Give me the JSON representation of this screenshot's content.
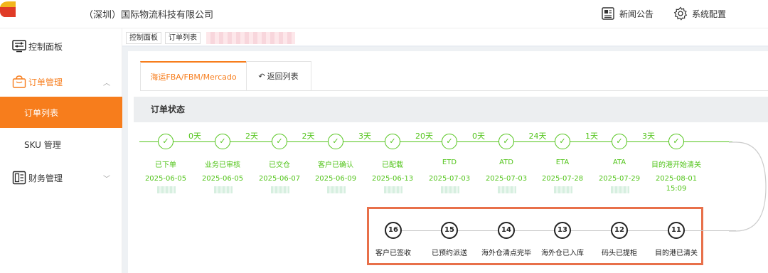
{
  "header": {
    "company": "（深圳）国际物流科技有限公司",
    "news_label": "新闻公告",
    "config_label": "系统配置"
  },
  "sidebar": {
    "items": [
      {
        "label": "控制面板",
        "icon": "dashboard-icon"
      },
      {
        "label": "订单管理",
        "icon": "shopping-bag-icon",
        "color": "#f77d1c"
      },
      {
        "label": "订单列表",
        "active": true
      },
      {
        "label": "SKU 管理"
      },
      {
        "label": "财务管理",
        "icon": "ledger-icon"
      }
    ]
  },
  "tabs": [
    "控制面板",
    "订单列表"
  ],
  "panel": {
    "active_tab": "海运FBA/FBM/Mercado",
    "back_tab": "返回列表",
    "section_title": "订单状态"
  },
  "steps": [
    {
      "label": "已下单",
      "date": "2025-06-05"
    },
    {
      "label": "业务已审核",
      "date": "2025-06-05"
    },
    {
      "label": "已交仓",
      "date": "2025-06-07"
    },
    {
      "label": "客户已确认",
      "date": "2025-06-09"
    },
    {
      "label": "已配载",
      "date": "2025-06-13"
    },
    {
      "label": "ETD",
      "date": "2025-07-03"
    },
    {
      "label": "ATD",
      "date": "2025-07-03"
    },
    {
      "label": "ETA",
      "date": "2025-07-28"
    },
    {
      "label": "ATA",
      "date": "2025-07-29"
    },
    {
      "label": "目的港开始清关",
      "date": "2025-08-01",
      "time": "15:09"
    }
  ],
  "durations": [
    "0天",
    "2天",
    "2天",
    "3天",
    "20天",
    "0天",
    "24天",
    "1天",
    "3天"
  ],
  "pending_steps": [
    {
      "num": "16",
      "label": "客户已签收"
    },
    {
      "num": "15",
      "label": "已预约派送"
    },
    {
      "num": "14",
      "label": "海外仓清点完毕"
    },
    {
      "num": "13",
      "label": "海外仓已入库"
    },
    {
      "num": "12",
      "label": "码头已提柜"
    },
    {
      "num": "11",
      "label": "目的港已清关"
    }
  ],
  "colors": {
    "accent": "#f77d1c",
    "done": "#52c41a",
    "highlight": "#e8704a"
  }
}
